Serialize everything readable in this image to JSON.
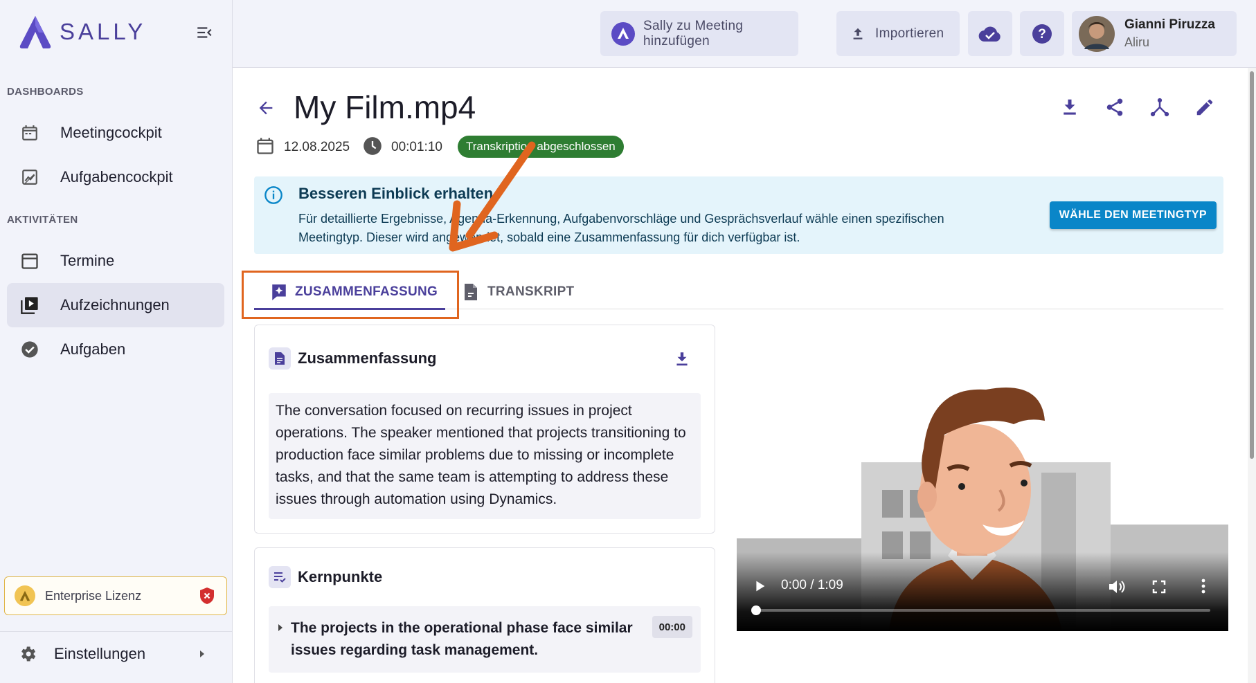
{
  "app": {
    "logo_text": "SALLY"
  },
  "sidebar": {
    "sections": [
      {
        "label": "DASHBOARDS"
      },
      {
        "label": "AKTIVITÄTEN"
      }
    ],
    "items": [
      {
        "label": "Meetingcockpit",
        "icon": "calendar-icon"
      },
      {
        "label": "Aufgabencockpit",
        "icon": "chart-icon"
      },
      {
        "label": "Termine",
        "icon": "calendar-icon"
      },
      {
        "label": "Aufzeichnungen",
        "icon": "video-library-icon",
        "active": true
      },
      {
        "label": "Aufgaben",
        "icon": "check-circle-icon"
      }
    ],
    "license": "Enterprise Lizenz",
    "settings": "Einstellungen"
  },
  "topbar": {
    "add_to_meeting": "Sally zu Meeting hinzufügen",
    "import": "Importieren",
    "user": {
      "name": "Gianni Piruzza",
      "org": "Aliru"
    }
  },
  "recording": {
    "title": "My Film.mp4",
    "date": "12.08.2025",
    "duration": "00:01:10",
    "status": "Transkription abgeschlossen"
  },
  "info": {
    "title": "Besseren Einblick erhalten",
    "body": "Für detaillierte Ergebnisse, Agenda-Erkennung, Aufgabenvorschläge und Gesprächsverlauf wähle einen spezifischen Meetingtyp. Dieser wird angewendet, sobald eine Zusammenfassung für dich verfügbar ist.",
    "button": "WÄHLE DEN MEETINGTYP"
  },
  "tabs": [
    {
      "label": "ZUSAMMENFASSUNG",
      "active": true
    },
    {
      "label": "TRANSKRIPT",
      "active": false
    }
  ],
  "summary": {
    "heading": "Zusammenfassung",
    "text": "The conversation focused on recurring issues in project operations. The speaker mentioned that projects transitioning to production face similar problems due to missing or incomplete tasks, and that the same team is attempting to address these issues through automation using Dynamics."
  },
  "keypoints": {
    "heading": "Kernpunkte",
    "items": [
      {
        "text": "The projects in the operational phase face similar issues regarding task management.",
        "time": "00:00"
      }
    ]
  },
  "video": {
    "time": "0:00 / 1:09",
    "progress": 0
  },
  "colors": {
    "brand": "#4a3f9b",
    "accent": "#0a86c8",
    "success": "#2e7d32",
    "highlight": "#e0651f"
  }
}
